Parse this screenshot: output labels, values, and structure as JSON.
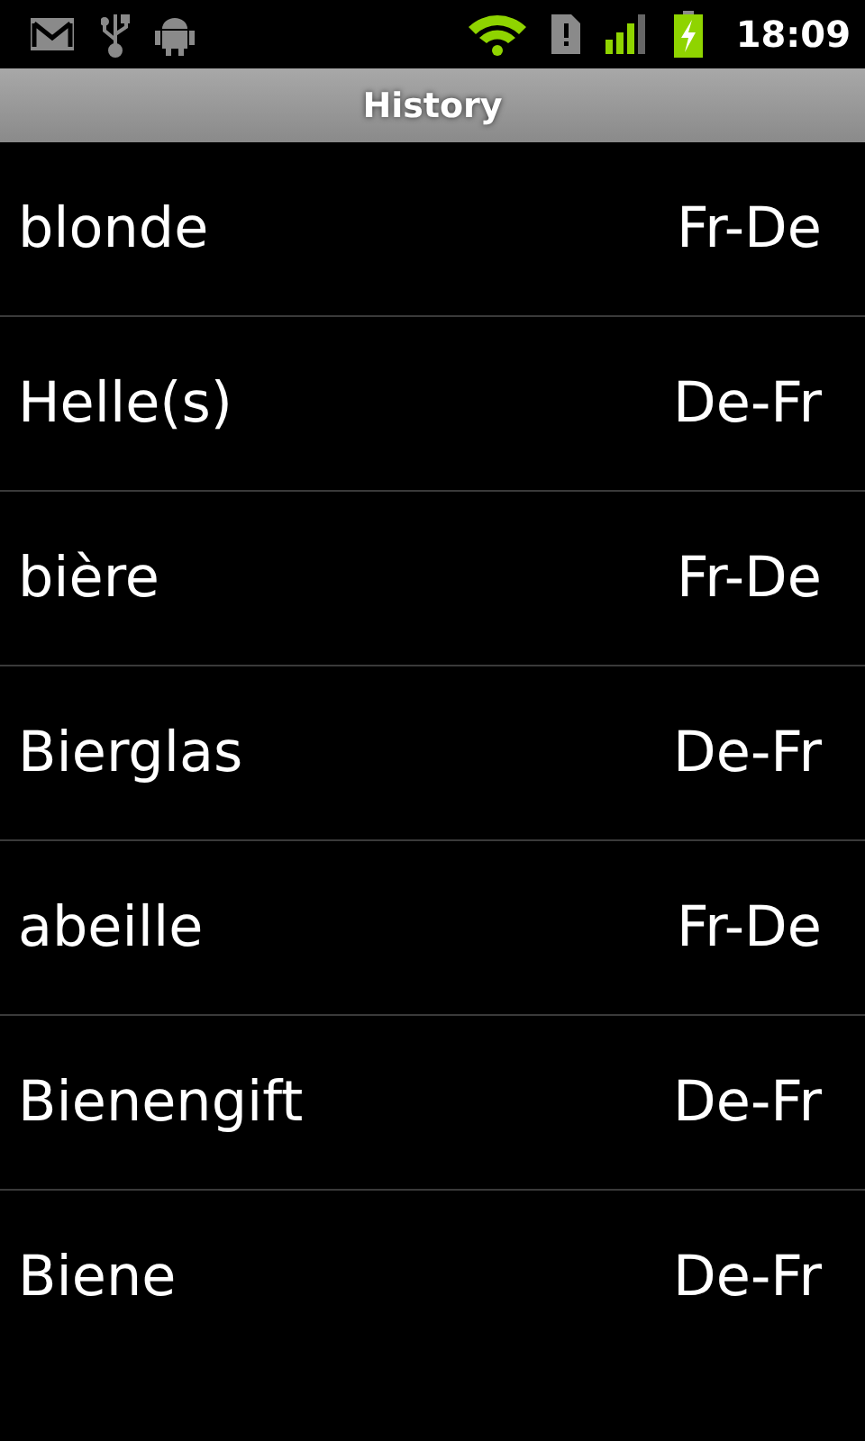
{
  "status_bar": {
    "time": "18:09"
  },
  "title_bar": {
    "title": "History"
  },
  "history": [
    {
      "word": "blonde",
      "direction": "Fr-De"
    },
    {
      "word": "Helle(s)",
      "direction": "De-Fr"
    },
    {
      "word": "bière",
      "direction": "Fr-De"
    },
    {
      "word": "Bierglas",
      "direction": "De-Fr"
    },
    {
      "word": "abeille",
      "direction": "Fr-De"
    },
    {
      "word": "Bienengift",
      "direction": "De-Fr"
    },
    {
      "word": "Biene",
      "direction": "De-Fr"
    }
  ]
}
